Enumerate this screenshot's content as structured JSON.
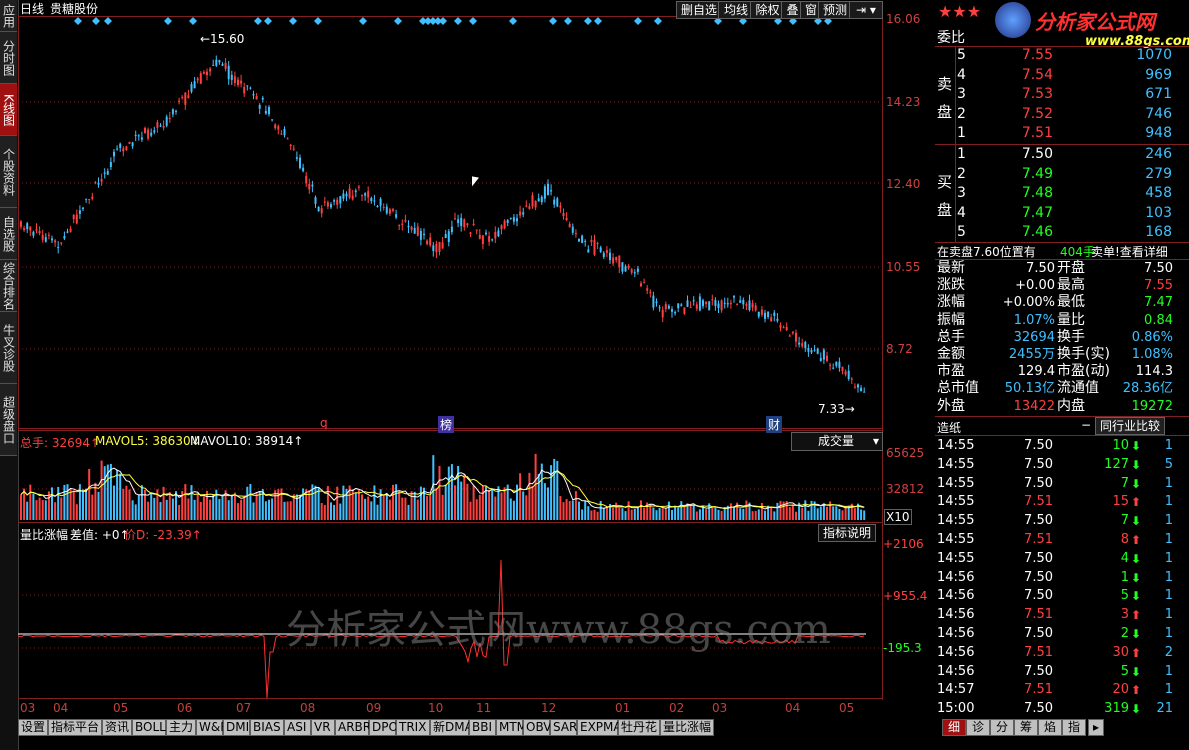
{
  "leftnav": [
    "应用",
    "分时图",
    "K线图",
    "个股资料",
    "自选股",
    "综合排名",
    "牛叉诊股",
    "超级盘口"
  ],
  "header": {
    "period": "日线",
    "stock_name": "贵糖股份"
  },
  "toolbar": [
    "删自选",
    "均线",
    "除权",
    "叠",
    "窗",
    "预测"
  ],
  "price_axis": [
    "16.06",
    "14.23",
    "12.40",
    "10.55",
    "8.72"
  ],
  "annotations": {
    "high": "←15.60",
    "low": "7.33→",
    "event_q": "q",
    "event_bang": "榜",
    "event_cai": "财"
  },
  "volume_panel": {
    "total_label": "总手: 32694↑",
    "mavol5": "MAVOL5: 38630↓",
    "mavol10": "MAVOL10: 38914↑",
    "dropdown": "成交量",
    "axis": [
      "65625",
      "32812"
    ],
    "unit": "X10"
  },
  "indicator_panel": {
    "title": "量比涨幅",
    "diff": "差值: +0↑",
    "price_d": "价D: -23.39↑",
    "help_button": "指标说明",
    "axis": [
      "+2106",
      "+955.4",
      "-195.3"
    ]
  },
  "x_axis": [
    "03",
    "04",
    "05",
    "06",
    "07",
    "08",
    "09",
    "10",
    "11",
    "12",
    "01",
    "02",
    "03",
    "04",
    "05"
  ],
  "bottom_tabs": [
    "设置",
    "指标平台",
    "资讯",
    "BOLL",
    "主力",
    "W&R",
    "DMI",
    "BIAS",
    "ASI",
    "VR",
    "ARBR",
    "DPO",
    "TRIX",
    "新DMA",
    "BBI",
    "MTM",
    "OBV",
    "SAR",
    "EXPMA",
    "牡丹花",
    "量比涨幅"
  ],
  "right_tabs": [
    "细",
    "诊",
    "分",
    "筹",
    "焰",
    "指"
  ],
  "watermark": {
    "logo_text": "分析家公式网",
    "logo_url": "www.88gs.com",
    "center": "分析家公式网www.88gs.com"
  },
  "quote": {
    "stars": "★★★",
    "title": "委比",
    "sell_label": "卖盘",
    "buy_label": "买盘",
    "sell": [
      {
        "lvl": "5",
        "price": "7.55",
        "vol": "1070"
      },
      {
        "lvl": "4",
        "price": "7.54",
        "vol": "969"
      },
      {
        "lvl": "3",
        "price": "7.53",
        "vol": "671"
      },
      {
        "lvl": "2",
        "price": "7.52",
        "vol": "746"
      },
      {
        "lvl": "1",
        "price": "7.51",
        "vol": "948"
      }
    ],
    "buy": [
      {
        "lvl": "1",
        "price": "7.50",
        "vol": "246"
      },
      {
        "lvl": "2",
        "price": "7.49",
        "vol": "279"
      },
      {
        "lvl": "3",
        "price": "7.48",
        "vol": "458"
      },
      {
        "lvl": "4",
        "price": "7.47",
        "vol": "103"
      },
      {
        "lvl": "5",
        "price": "7.46",
        "vol": "168"
      }
    ],
    "pending": "在卖盘7.60位置有",
    "pending_vol": "404手",
    "pending_link": "卖单!查看详细",
    "stats": [
      {
        "l1": "最新",
        "v1": "7.50",
        "l2": "开盘",
        "v2": "7.50",
        "c1": "wht",
        "c2": "wht"
      },
      {
        "l1": "涨跌",
        "v1": "+0.00",
        "l2": "最高",
        "v2": "7.55",
        "c1": "wht",
        "c2": "red"
      },
      {
        "l1": "涨幅",
        "v1": "+0.00%",
        "l2": "最低",
        "v2": "7.47",
        "c1": "wht",
        "c2": "grn"
      },
      {
        "l1": "振幅",
        "v1": "1.07%",
        "l2": "量比",
        "v2": "0.84",
        "c1": "cyan",
        "c2": "grn"
      },
      {
        "l1": "总手",
        "v1": "32694",
        "l2": "换手",
        "v2": "0.86%",
        "c1": "cyan",
        "c2": "cyan"
      },
      {
        "l1": "金额",
        "v1": "2455万",
        "l2": "换手(实)",
        "v2": "1.08%",
        "c1": "cyan",
        "c2": "cyan"
      },
      {
        "l1": "市盈",
        "v1": "129.4",
        "l2": "市盈(动)",
        "v2": "114.3",
        "c1": "wht",
        "c2": "wht"
      },
      {
        "l1": "总市值",
        "v1": "50.13亿",
        "l2": "流通值",
        "v2": "28.36亿",
        "c1": "cyan",
        "c2": "cyan"
      },
      {
        "l1": "外盘",
        "v1": "13422",
        "l2": "内盘",
        "v2": "19272",
        "c1": "red",
        "c2": "grn"
      }
    ],
    "industry_label": "造纸",
    "industry_dash": "−",
    "industry_compare": "同行业比较",
    "ticks": [
      {
        "t": "14:55",
        "p": "7.50",
        "v": "10",
        "d": "dn",
        "n": "1"
      },
      {
        "t": "14:55",
        "p": "7.50",
        "v": "127",
        "d": "dn",
        "n": "5"
      },
      {
        "t": "14:55",
        "p": "7.50",
        "v": "7",
        "d": "dn",
        "n": "1"
      },
      {
        "t": "14:55",
        "p": "7.51",
        "v": "15",
        "d": "up",
        "n": "1"
      },
      {
        "t": "14:55",
        "p": "7.50",
        "v": "7",
        "d": "dn",
        "n": "1"
      },
      {
        "t": "14:55",
        "p": "7.51",
        "v": "8",
        "d": "up",
        "n": "1"
      },
      {
        "t": "14:55",
        "p": "7.50",
        "v": "4",
        "d": "dn",
        "n": "1"
      },
      {
        "t": "14:56",
        "p": "7.50",
        "v": "1",
        "d": "dn",
        "n": "1"
      },
      {
        "t": "14:56",
        "p": "7.50",
        "v": "5",
        "d": "dn",
        "n": "1"
      },
      {
        "t": "14:56",
        "p": "7.51",
        "v": "3",
        "d": "up",
        "n": "1"
      },
      {
        "t": "14:56",
        "p": "7.50",
        "v": "2",
        "d": "dn",
        "n": "1"
      },
      {
        "t": "14:56",
        "p": "7.51",
        "v": "30",
        "d": "up",
        "n": "2"
      },
      {
        "t": "14:56",
        "p": "7.50",
        "v": "5",
        "d": "dn",
        "n": "1"
      },
      {
        "t": "14:57",
        "p": "7.51",
        "v": "20",
        "d": "up",
        "n": "1"
      },
      {
        "t": "15:00",
        "p": "7.50",
        "v": "319",
        "d": "dn",
        "n": "21"
      }
    ]
  },
  "colors": {
    "up": "#ff4040",
    "down": "#40c0ff",
    "grid": "#802020",
    "ma5": "#ffffff",
    "ma10": "#ffff40"
  }
}
